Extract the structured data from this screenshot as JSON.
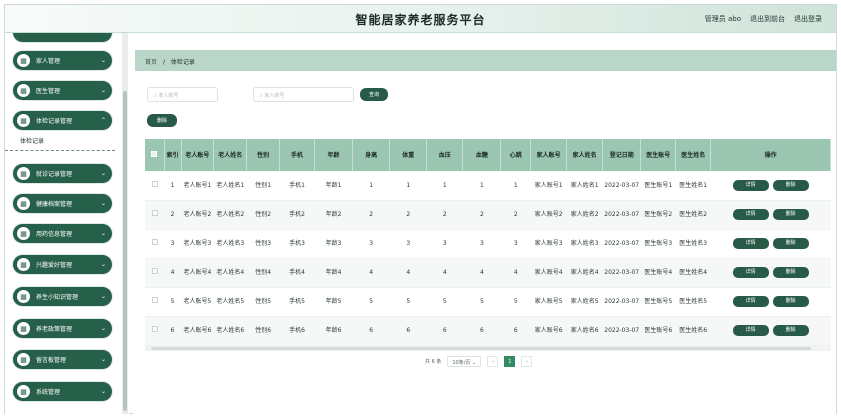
{
  "header": {
    "title": "智能居家养老服务平台",
    "admin_label": "管理员 abo",
    "exit_front_label": "退出到前台",
    "logout_label": "退出登录"
  },
  "sidebar": {
    "items": [
      {
        "label": "家人管理"
      },
      {
        "label": "医生管理"
      },
      {
        "label": "体检记录管理"
      },
      {
        "label": "就诊记录管理"
      },
      {
        "label": "健康档案管理"
      },
      {
        "label": "用药信息管理"
      },
      {
        "label": "兴趣爱好管理"
      },
      {
        "label": "养生小知识管理"
      },
      {
        "label": "养老政策管理"
      },
      {
        "label": "留言板管理"
      },
      {
        "label": "系统管理"
      }
    ],
    "submenu_label": "体检记录"
  },
  "breadcrumb": {
    "home": "首页",
    "separator": "/",
    "current": "体检记录"
  },
  "search": {
    "elder_account_placeholder": "老人账号",
    "family_account_placeholder": "家人账号",
    "search_label": "查询",
    "delete_label": "删除"
  },
  "table": {
    "headers": [
      "索引",
      "老人账号",
      "老人姓名",
      "性别",
      "手机",
      "年龄",
      "身高",
      "体重",
      "血压",
      "血糖",
      "心跳",
      "家人账号",
      "家人姓名",
      "登记日期",
      "医生账号",
      "医生姓名",
      "操作"
    ],
    "rows": [
      [
        "1",
        "老人账号1",
        "老人姓名1",
        "性别1",
        "手机1",
        "年龄1",
        "1",
        "1",
        "1",
        "1",
        "1",
        "家人账号1",
        "家人姓名1",
        "2022-03-07",
        "医生账号1",
        "医生姓名1"
      ],
      [
        "2",
        "老人账号2",
        "老人姓名2",
        "性别2",
        "手机2",
        "年龄2",
        "2",
        "2",
        "2",
        "2",
        "2",
        "家人账号2",
        "家人姓名2",
        "2022-03-07",
        "医生账号2",
        "医生姓名2"
      ],
      [
        "3",
        "老人账号3",
        "老人姓名3",
        "性别3",
        "手机3",
        "年龄3",
        "3",
        "3",
        "3",
        "3",
        "3",
        "家人账号3",
        "家人姓名3",
        "2022-03-07",
        "医生账号3",
        "医生姓名3"
      ],
      [
        "4",
        "老人账号4",
        "老人姓名4",
        "性别4",
        "手机4",
        "年龄4",
        "4",
        "4",
        "4",
        "4",
        "4",
        "家人账号4",
        "家人姓名4",
        "2022-03-07",
        "医生账号4",
        "医生姓名4"
      ],
      [
        "5",
        "老人账号5",
        "老人姓名5",
        "性别5",
        "手机5",
        "年龄5",
        "5",
        "5",
        "5",
        "5",
        "5",
        "家人账号5",
        "家人姓名5",
        "2022-03-07",
        "医生账号5",
        "医生姓名5"
      ],
      [
        "6",
        "老人账号6",
        "老人姓名6",
        "性别6",
        "手机6",
        "年龄6",
        "6",
        "6",
        "6",
        "6",
        "6",
        "家人账号6",
        "家人姓名6",
        "2022-03-07",
        "医生账号6",
        "医生姓名6"
      ]
    ],
    "detail_label": "详情",
    "row_delete_label": "删除"
  },
  "pagination": {
    "total": "共 6 条",
    "page_size": "10条/页",
    "current_page": "1",
    "prev": "‹",
    "next": "›"
  },
  "colors": {
    "accent": "#285b47",
    "header_bg": "#9bc6b2",
    "crumb_bg": "#b9d6c9"
  }
}
